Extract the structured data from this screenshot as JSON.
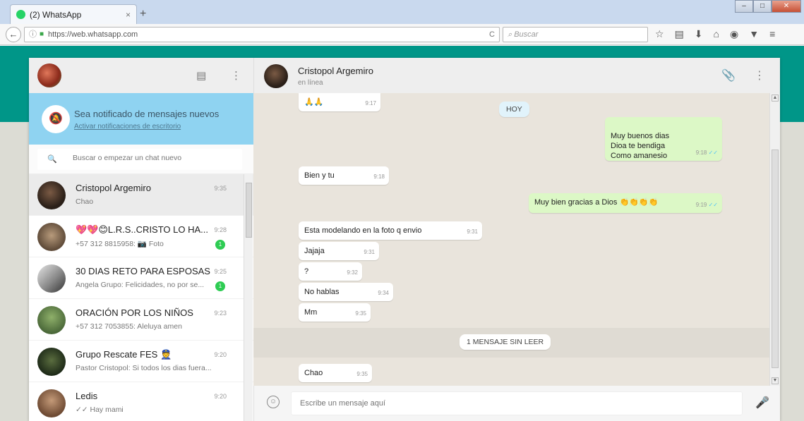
{
  "browser": {
    "tab_title": "(2) WhatsApp",
    "tab_close": "×",
    "new_tab": "+",
    "url": "https://web.whatsapp.com",
    "search_placeholder": "Buscar",
    "reload": "C"
  },
  "sidebar": {
    "notification": {
      "title": "Sea notificado de mensajes nuevos",
      "link": "Activar notificaciones de escritorio"
    },
    "search_placeholder": "Buscar o empezar un chat nuevo",
    "chats": [
      {
        "name": "Cristopol Argemiro",
        "time": "9:35",
        "preview": "Chao",
        "badge": null
      },
      {
        "name": "💖💖😊L.R.S..CRISTO LO HA...",
        "time": "9:28",
        "preview": "+57 312 8815958: 📷 Foto",
        "badge": "1"
      },
      {
        "name": "30 DIAS RETO PARA ESPOSAS",
        "time": "9:25",
        "preview": "Angela Grupo: Felicidades, no por se...",
        "badge": "1"
      },
      {
        "name": "ORACIÓN POR LOS NIÑOS",
        "time": "9:23",
        "preview": "+57 312 7053855: Aleluya amen",
        "badge": null
      },
      {
        "name": "Grupo Rescate FES 👮",
        "time": "9:20",
        "preview": "Pastor Cristopol: Si todos los dias fuera...",
        "badge": null
      },
      {
        "name": "Ledis",
        "time": "9:20",
        "preview": "✓✓ Hay mami",
        "badge": null
      }
    ]
  },
  "conversation": {
    "contact_name": "Cristopol Argemiro",
    "contact_status": "en línea",
    "messages": [
      {
        "dir": "in",
        "text": "🙏🙏",
        "time": "9:17"
      },
      {
        "dir": "system",
        "text": "HOY"
      },
      {
        "dir": "out",
        "text": "Muy buenos dias\nDioa te bendiga\nComo amanesio",
        "time": "9:18 ✓✓"
      },
      {
        "dir": "in",
        "text": "Bien y tu",
        "time": "9:18"
      },
      {
        "dir": "out",
        "text": "Muy bien gracias a Dios 👏👏👏👏",
        "time": "9:19 ✓✓"
      },
      {
        "dir": "in",
        "text": "Esta modelando en la foto q envio",
        "time": "9:31"
      },
      {
        "dir": "in",
        "text": "Jajaja",
        "time": "9:31"
      },
      {
        "dir": "in",
        "text": "?",
        "time": "9:32"
      },
      {
        "dir": "in",
        "text": "No hablas",
        "time": "9:34"
      },
      {
        "dir": "in",
        "text": "Mm",
        "time": "9:35"
      },
      {
        "dir": "system",
        "text": "1 MENSAJE SIN LEER"
      },
      {
        "dir": "in",
        "text": "Chao",
        "time": "9:35"
      }
    ],
    "composer_placeholder": "Escribe un mensaje aquí"
  },
  "colors": {
    "teal": "#009688",
    "outgoing": "#dcf8c6",
    "notification": "#8fd3f1",
    "unread_badge": "#2ecc53"
  },
  "icons": [
    "back-arrow-icon",
    "lock-icon",
    "reload-icon",
    "search-icon",
    "star-icon",
    "bookmark-list-icon",
    "download-icon",
    "home-icon",
    "pocket-icon",
    "shield-icon",
    "menu-icon",
    "chat-icon",
    "more-icon",
    "bell-off-icon",
    "attach-icon",
    "emoji-icon",
    "mic-icon",
    "double-check-icon"
  ]
}
